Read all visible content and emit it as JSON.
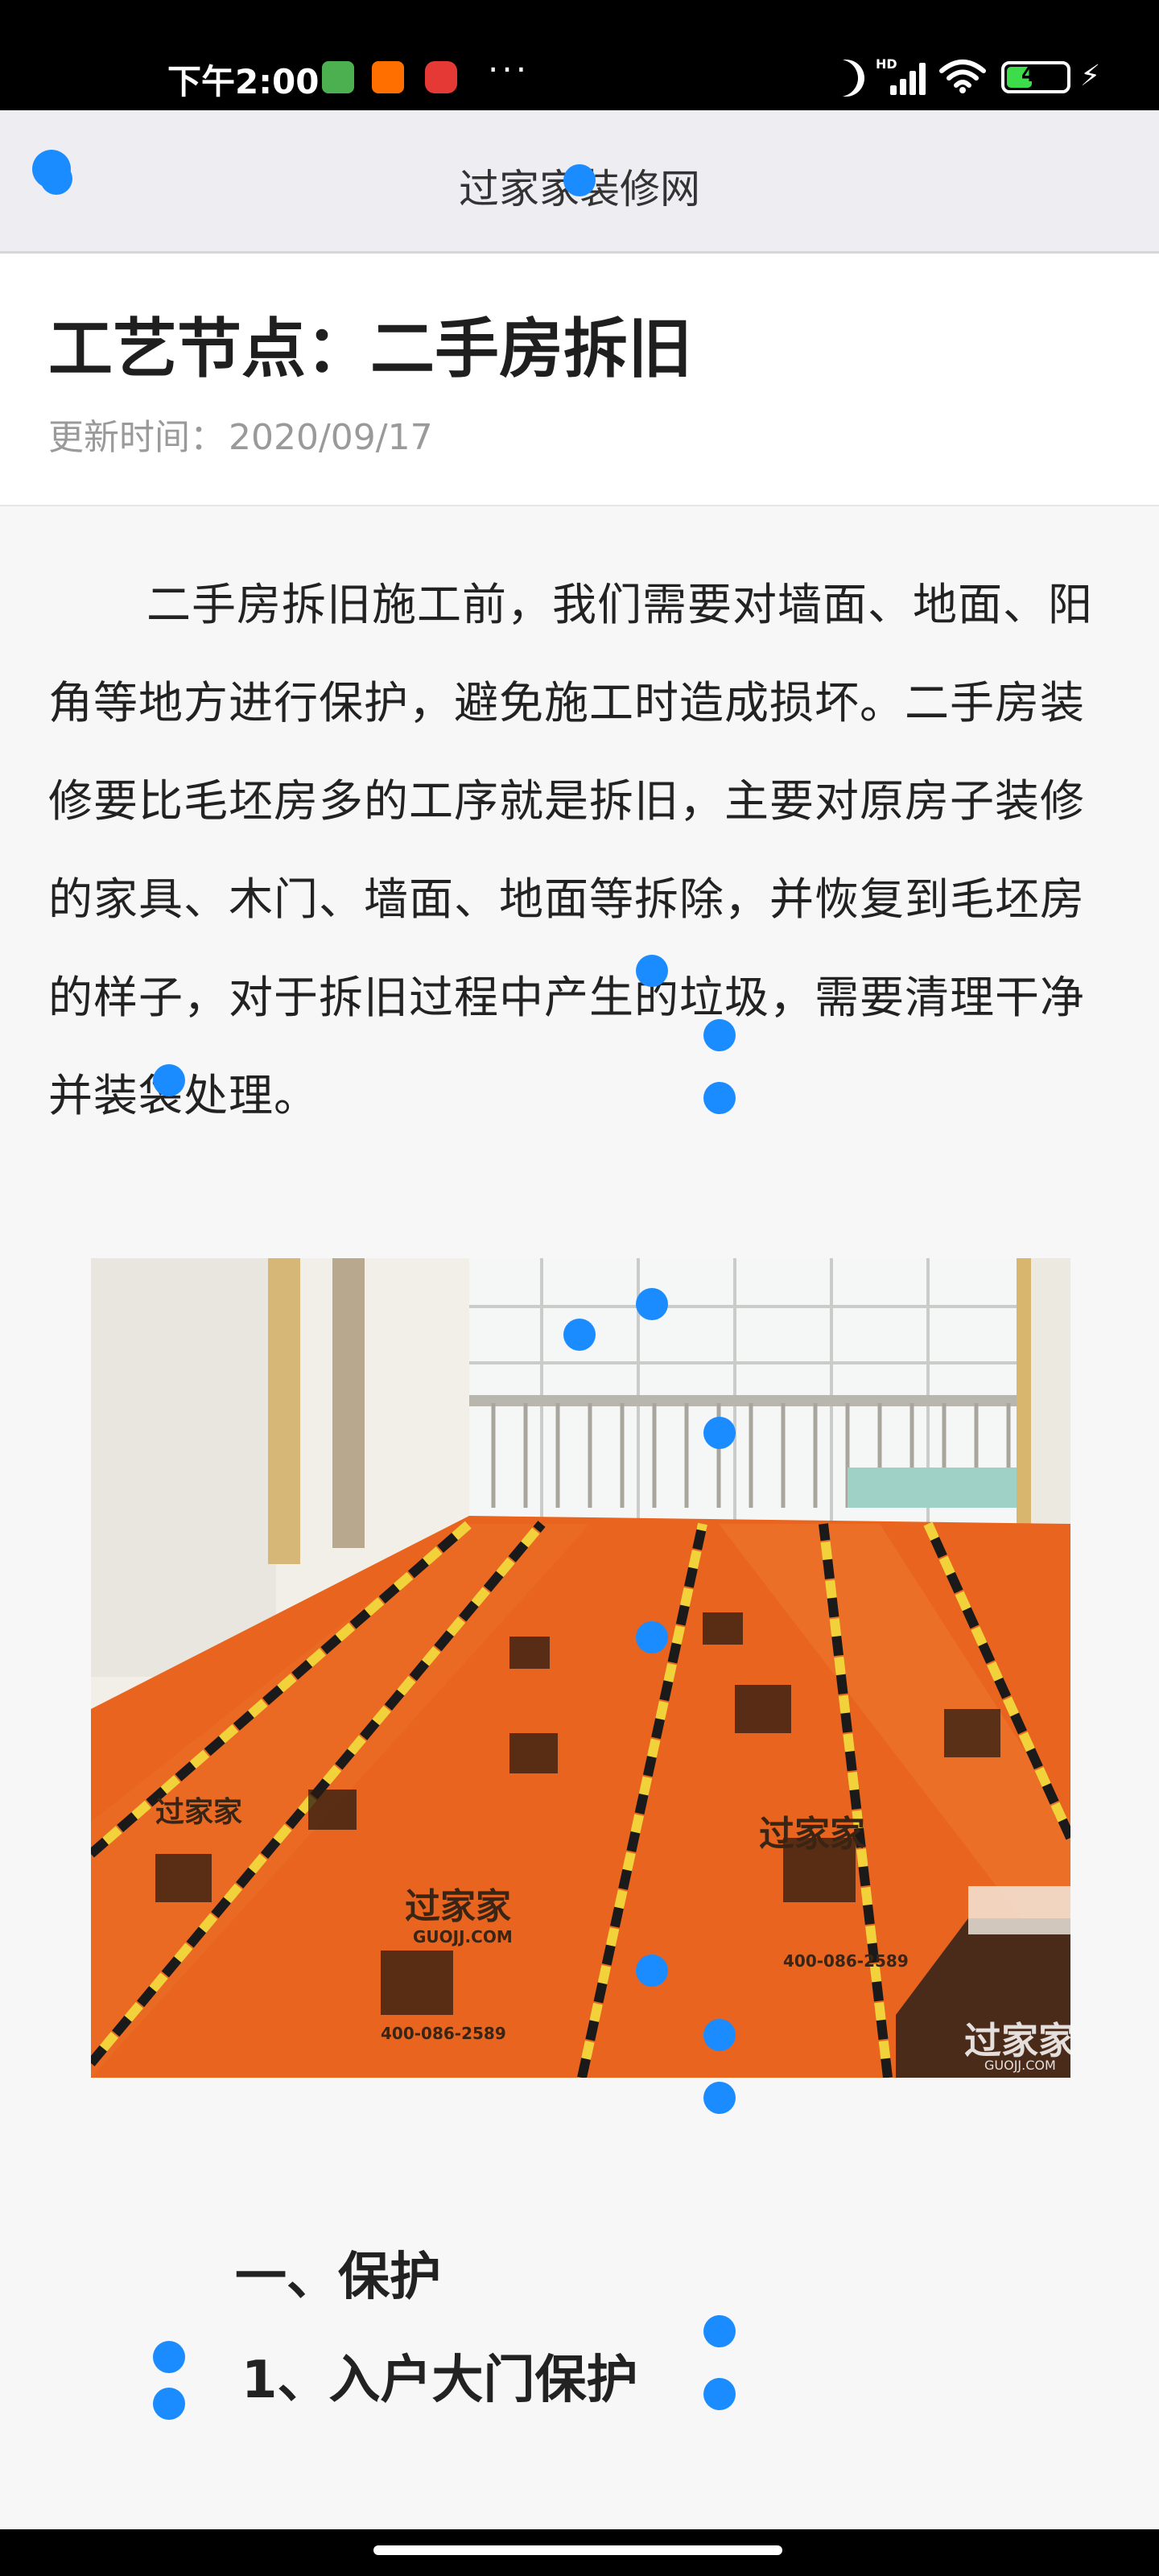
{
  "status_bar": {
    "time": "下午2:00",
    "more": "···",
    "network_badge": "HD",
    "battery_level": "40",
    "battery_fraction": 0.4,
    "icons": [
      "green-app-icon",
      "orange-app-icon",
      "red-app-icon",
      "moon-icon",
      "signal-icon",
      "wifi-icon",
      "battery-icon",
      "charging-icon"
    ]
  },
  "app_bar": {
    "title": "过家家装修网",
    "back_icon": "back-icon"
  },
  "header": {
    "title": "工艺节点：二手房拆旧",
    "update_label": "更新时间：",
    "update_date": "2020/09/17"
  },
  "article": {
    "paragraph": "二手房拆旧施工前，我们需要对墙面、地面、阳角等地方进行保护，避免施工时造成损坏。二手房装修要比毛坯房多的工序就是拆旧，主要对原房子装修的家具、木门、墙面、地面等拆除，并恢复到毛坯房的样子，对于拆旧过程中产生的垃圾，需要清理干净并装袋处理。",
    "photo": {
      "watermark": "过家家",
      "watermark_sub": "GUOJJ.COM",
      "floor_print_brand": "过家家",
      "floor_print_site": "GUOJJ.COM",
      "floor_print_phone": "400-086-2589"
    },
    "section_heading": "一、保护",
    "sub_heading": "1、入户大门保护"
  },
  "colors": {
    "accent": "#1a8cff",
    "protective_film": "#e8641f",
    "background": "#f7f7f7"
  }
}
